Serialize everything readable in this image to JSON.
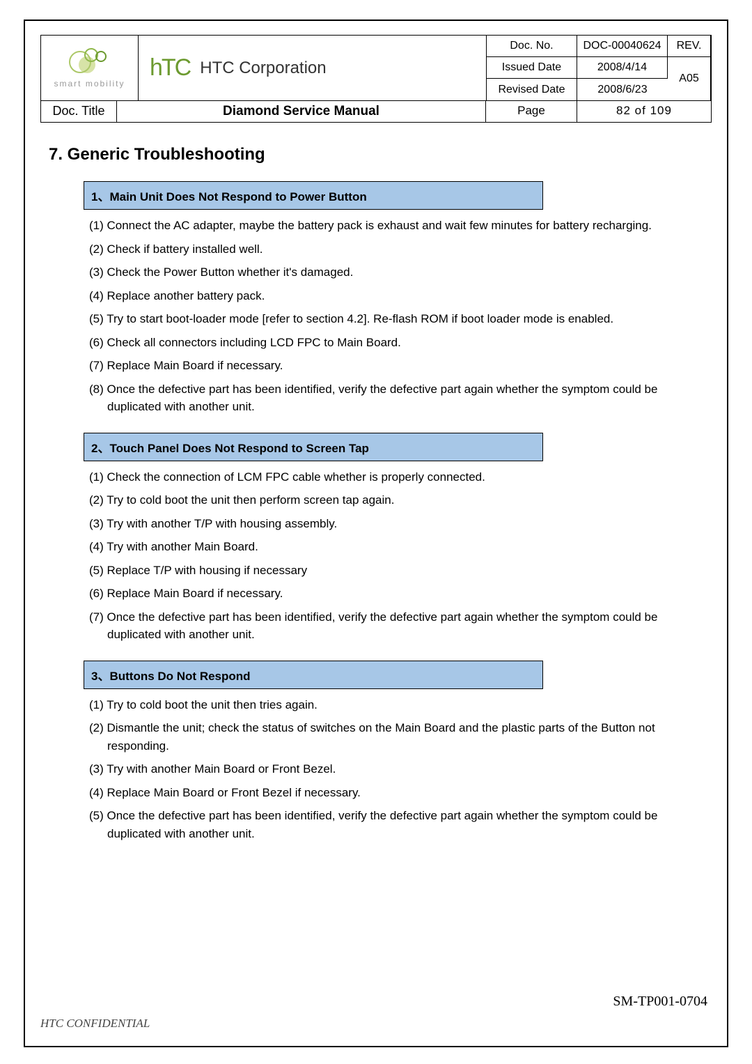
{
  "header": {
    "smart_mobility": "smart mobility",
    "htc_logo": "hTC",
    "company": "HTC Corporation",
    "doc_no_label": "Doc. No.",
    "doc_no": "DOC-00040624",
    "rev_label": "REV.",
    "rev": "A05",
    "issued_label": "Issued Date",
    "issued": "2008/4/14",
    "revised_label": "Revised Date",
    "revised": "2008/6/23",
    "title_label": "Doc. Title",
    "title": "Diamond Service Manual",
    "page_label": "Page",
    "page": "82  of  109"
  },
  "section_title": "7.   Generic Troubleshooting",
  "blocks": [
    {
      "title": "1、Main Unit Does Not Respond to Power Button",
      "steps": [
        "(1) Connect the AC adapter, maybe the battery pack is exhaust and wait few minutes for battery recharging.",
        "(2) Check if battery installed well.",
        "(3) Check the Power Button whether it's damaged.",
        "(4) Replace another battery pack.",
        "(5) Try to start boot-loader mode [refer to section 4.2]. Re-flash ROM if boot loader mode is enabled.",
        "(6) Check all connectors including LCD FPC to Main Board.",
        "(7) Replace Main Board if necessary.",
        "(8) Once the defective part has been identified, verify the defective part again whether the symptom could be duplicated with another unit."
      ]
    },
    {
      "title": "2、Touch Panel Does Not Respond to Screen Tap",
      "steps": [
        "(1) Check the connection of LCM FPC cable whether is properly connected.",
        "(2) Try to cold boot the unit then perform screen tap again.",
        "(3) Try with another T/P with housing assembly.",
        "(4) Try with another Main Board.",
        "(5) Replace T/P with housing if necessary",
        "(6) Replace Main Board if necessary.",
        "(7) Once the defective part has been identified, verify the defective part again whether the symptom could be duplicated with another unit."
      ]
    },
    {
      "title": "3、Buttons Do Not Respond",
      "steps": [
        "(1) Try to cold boot the unit then tries again.",
        "(2) Dismantle the unit; check the status of switches on the Main Board and the plastic parts of the Button not responding.",
        "(3) Try with another Main Board or Front Bezel.",
        "(4) Replace Main Board or Front Bezel if necessary.",
        "(5) Once the defective part has been identified, verify the defective part again whether the symptom could be duplicated with another unit."
      ]
    }
  ],
  "footer": {
    "left": "HTC CONFIDENTIAL",
    "right": "SM-TP001-0704"
  }
}
